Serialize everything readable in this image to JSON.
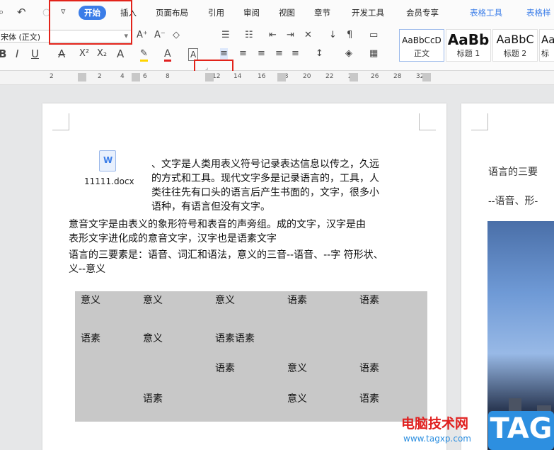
{
  "toolbar": {
    "tabs": [
      "开始",
      "插入",
      "页面布局",
      "引用",
      "审阅",
      "视图",
      "章节",
      "开发工具",
      "会员专享",
      "表格工具",
      "表格样"
    ],
    "font_name": "宋体 (正文)",
    "icons": {
      "print_preview": "⌕",
      "undo": "↶",
      "redo": "○",
      "quick_menu": "▿",
      "grow_font": "A⁺",
      "shrink_font": "A⁻",
      "clear_format": "◇",
      "bullets": "☰",
      "numbering": "☷",
      "indent_dec": "⇤",
      "indent_inc": "⇥",
      "chinese_layout": "✕",
      "sort": "↓",
      "show_marks": "¶",
      "bold": "B",
      "italic": "I",
      "underline": "U",
      "strike": "A",
      "superscript": "X²",
      "subscript": "X₂",
      "text_effect": "A",
      "highlight": "✎",
      "font_color": "A",
      "char_border": "A",
      "align_left": "≡",
      "align_center": "≡",
      "align_right": "≡",
      "justify": "≡",
      "distribute": "≡",
      "line_spacing": "↕",
      "shading": "◈",
      "borders": "▦"
    },
    "styles": [
      {
        "sample": "AaBbCcD",
        "label": "正文"
      },
      {
        "sample": "AaBb",
        "label": "标题 1"
      },
      {
        "sample": "AaBbC",
        "label": "标题 2"
      },
      {
        "sample": "AaB",
        "label": "标"
      }
    ]
  },
  "ruler": {
    "numbers": [
      "2",
      "2",
      "4",
      "6",
      "8",
      "12",
      "14",
      "16",
      "18",
      "20",
      "22",
      "24",
      "26",
      "28",
      "32"
    ]
  },
  "document": {
    "attachment_name": "11111.docx",
    "attachment_icon": "W",
    "para1_lines": [
      "、文字是人类用表义符号记录表达信息以传之，久远",
      "的方式和工具。现代文字多是记录语言的，工具，人",
      "类往往先有口头的语言后产生书面的，文字，很多小",
      "语种，有语言但没有文字。"
    ],
    "para2_lines": [
      "意音文字是由表义的象形符号和表音的声旁组。成的文字，汉字是由",
      "表形文字进化成的意音文字，汉字也是语素文字"
    ],
    "para3_lines": [
      "语言的三要素是：语音、词汇和语法，意义的三音--语音、--字  符形状、",
      "义--意义"
    ],
    "table": [
      [
        "意义",
        "意义",
        "意义",
        "语素",
        "语素"
      ],
      [
        "语素",
        "意义",
        "语素语素",
        "",
        ""
      ],
      [
        "",
        "",
        "语素",
        "意义",
        "语素"
      ],
      [
        "",
        "语素",
        "",
        "意义",
        "语素"
      ]
    ]
  },
  "page2": {
    "line1": "语言的三要",
    "line2": "--语音、形-"
  },
  "watermark": {
    "site_cn": "电脑技术网",
    "site_url": "www.tagxp.com",
    "tag": "TAG"
  }
}
